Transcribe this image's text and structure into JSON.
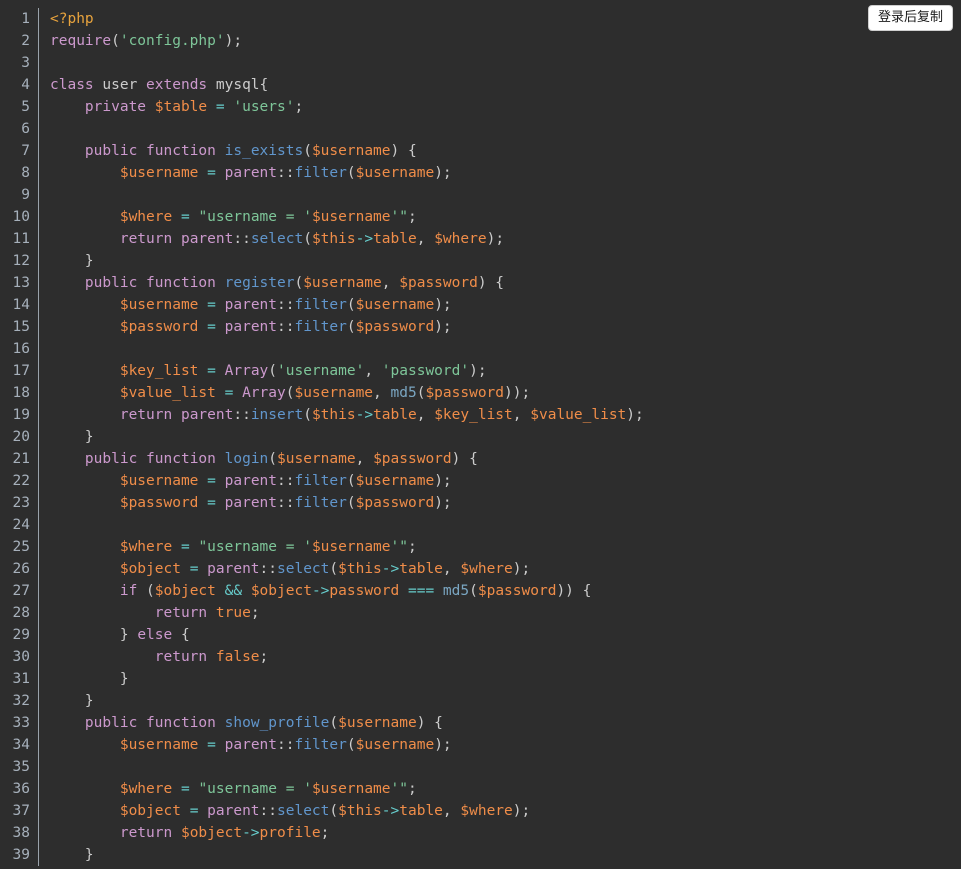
{
  "widget": {
    "type": "code-block",
    "language": "php",
    "theme": "dark",
    "background_color": "#2d2d2d",
    "default_text_color": "#cccccc",
    "gutter_separator_color": "#9aa3ab",
    "line_number_color": "#a6b0bb"
  },
  "copy_button": {
    "label": "登录后复制",
    "background_color": "#ffffff",
    "text_color": "#1a1a1a",
    "border_color": "#cfcfcf"
  },
  "token_colors": {
    "keyword": "#cc99cd",
    "function": "#6196cc",
    "builtin": "#7aa6c2",
    "variable": "#f08d49",
    "string": "#7ec699",
    "operator": "#67cdcc",
    "punctuation": "#cccccc",
    "php_tag": "#e8a33d",
    "boolean": "#f08d49",
    "property": "#f08d49",
    "classname": "#cccccc"
  },
  "line_numbers": [
    "1",
    "2",
    "3",
    "4",
    "5",
    "6",
    "7",
    "8",
    "9",
    "10",
    "11",
    "12",
    "13",
    "14",
    "15",
    "16",
    "17",
    "18",
    "19",
    "20",
    "21",
    "22",
    "23",
    "24",
    "25",
    "26",
    "27",
    "28",
    "29",
    "30",
    "31",
    "32",
    "33",
    "34",
    "35",
    "36",
    "37",
    "38",
    "39"
  ],
  "code_lines": [
    "<?php",
    "require('config.php');",
    "",
    "class user extends mysql{",
    "    private $table = 'users';",
    "",
    "    public function is_exists($username) {",
    "        $username = parent::filter($username);",
    "",
    "        $where = \"username = '$username'\";",
    "        return parent::select($this->table, $where);",
    "    }",
    "    public function register($username, $password) {",
    "        $username = parent::filter($username);",
    "        $password = parent::filter($password);",
    "",
    "        $key_list = Array('username', 'password');",
    "        $value_list = Array($username, md5($password));",
    "        return parent::insert($this->table, $key_list, $value_list);",
    "    }",
    "    public function login($username, $password) {",
    "        $username = parent::filter($username);",
    "        $password = parent::filter($password);",
    "",
    "        $where = \"username = '$username'\";",
    "        $object = parent::select($this->table, $where);",
    "        if ($object && $object->password === md5($password)) {",
    "            return true;",
    "        } else {",
    "            return false;",
    "        }",
    "    }",
    "    public function show_profile($username) {",
    "        $username = parent::filter($username);",
    "",
    "        $where = \"username = '$username'\";",
    "        $object = parent::select($this->table, $where);",
    "        return $object->profile;",
    "    }"
  ],
  "tokenized_lines": [
    [
      [
        "<?php",
        "tag"
      ]
    ],
    [
      [
        "require",
        "kw"
      ],
      [
        "(",
        "punct"
      ],
      [
        "'config.php'",
        "str"
      ],
      [
        ")",
        "punct"
      ],
      [
        ";",
        "punct"
      ]
    ],
    [],
    [
      [
        "class",
        "kw"
      ],
      [
        " ",
        "plain"
      ],
      [
        "user",
        "cls"
      ],
      [
        " ",
        "plain"
      ],
      [
        "extends",
        "kw"
      ],
      [
        " ",
        "plain"
      ],
      [
        "mysql",
        "cls"
      ],
      [
        "{",
        "punct"
      ]
    ],
    [
      [
        "    ",
        "plain"
      ],
      [
        "private",
        "kw"
      ],
      [
        " ",
        "plain"
      ],
      [
        "$table",
        "var"
      ],
      [
        " ",
        "plain"
      ],
      [
        "=",
        "op"
      ],
      [
        " ",
        "plain"
      ],
      [
        "'users'",
        "str"
      ],
      [
        ";",
        "punct"
      ]
    ],
    [],
    [
      [
        "    ",
        "plain"
      ],
      [
        "public",
        "kw"
      ],
      [
        " ",
        "plain"
      ],
      [
        "function",
        "kw"
      ],
      [
        " ",
        "plain"
      ],
      [
        "is_exists",
        "fn"
      ],
      [
        "(",
        "punct"
      ],
      [
        "$username",
        "var"
      ],
      [
        ")",
        "punct"
      ],
      [
        " ",
        "plain"
      ],
      [
        "{",
        "punct"
      ]
    ],
    [
      [
        "        ",
        "plain"
      ],
      [
        "$username",
        "var"
      ],
      [
        " ",
        "plain"
      ],
      [
        "=",
        "op"
      ],
      [
        " ",
        "plain"
      ],
      [
        "parent",
        "kw"
      ],
      [
        "::",
        "punct"
      ],
      [
        "filter",
        "fn"
      ],
      [
        "(",
        "punct"
      ],
      [
        "$username",
        "var"
      ],
      [
        ")",
        "punct"
      ],
      [
        ";",
        "punct"
      ]
    ],
    [],
    [
      [
        "        ",
        "plain"
      ],
      [
        "$where",
        "var"
      ],
      [
        " ",
        "plain"
      ],
      [
        "=",
        "op"
      ],
      [
        " ",
        "plain"
      ],
      [
        "\"username = '",
        "str"
      ],
      [
        "$username",
        "var"
      ],
      [
        "'\"",
        "str"
      ],
      [
        ";",
        "punct"
      ]
    ],
    [
      [
        "        ",
        "plain"
      ],
      [
        "return",
        "kw"
      ],
      [
        " ",
        "plain"
      ],
      [
        "parent",
        "kw"
      ],
      [
        "::",
        "punct"
      ],
      [
        "select",
        "fn"
      ],
      [
        "(",
        "punct"
      ],
      [
        "$this",
        "var"
      ],
      [
        "->",
        "op"
      ],
      [
        "table",
        "prop"
      ],
      [
        ",",
        "punct"
      ],
      [
        " ",
        "plain"
      ],
      [
        "$where",
        "var"
      ],
      [
        ")",
        "punct"
      ],
      [
        ";",
        "punct"
      ]
    ],
    [
      [
        "    ",
        "plain"
      ],
      [
        "}",
        "punct"
      ]
    ],
    [
      [
        "    ",
        "plain"
      ],
      [
        "public",
        "kw"
      ],
      [
        " ",
        "plain"
      ],
      [
        "function",
        "kw"
      ],
      [
        " ",
        "plain"
      ],
      [
        "register",
        "fn"
      ],
      [
        "(",
        "punct"
      ],
      [
        "$username",
        "var"
      ],
      [
        ",",
        "punct"
      ],
      [
        " ",
        "plain"
      ],
      [
        "$password",
        "var"
      ],
      [
        ")",
        "punct"
      ],
      [
        " ",
        "plain"
      ],
      [
        "{",
        "punct"
      ]
    ],
    [
      [
        "        ",
        "plain"
      ],
      [
        "$username",
        "var"
      ],
      [
        " ",
        "plain"
      ],
      [
        "=",
        "op"
      ],
      [
        " ",
        "plain"
      ],
      [
        "parent",
        "kw"
      ],
      [
        "::",
        "punct"
      ],
      [
        "filter",
        "fn"
      ],
      [
        "(",
        "punct"
      ],
      [
        "$username",
        "var"
      ],
      [
        ")",
        "punct"
      ],
      [
        ";",
        "punct"
      ]
    ],
    [
      [
        "        ",
        "plain"
      ],
      [
        "$password",
        "var"
      ],
      [
        " ",
        "plain"
      ],
      [
        "=",
        "op"
      ],
      [
        " ",
        "plain"
      ],
      [
        "parent",
        "kw"
      ],
      [
        "::",
        "punct"
      ],
      [
        "filter",
        "fn"
      ],
      [
        "(",
        "punct"
      ],
      [
        "$password",
        "var"
      ],
      [
        ")",
        "punct"
      ],
      [
        ";",
        "punct"
      ]
    ],
    [],
    [
      [
        "        ",
        "plain"
      ],
      [
        "$key_list",
        "var"
      ],
      [
        " ",
        "plain"
      ],
      [
        "=",
        "op"
      ],
      [
        " ",
        "plain"
      ],
      [
        "Array",
        "kw"
      ],
      [
        "(",
        "punct"
      ],
      [
        "'username'",
        "str"
      ],
      [
        ",",
        "punct"
      ],
      [
        " ",
        "plain"
      ],
      [
        "'password'",
        "str"
      ],
      [
        ")",
        "punct"
      ],
      [
        ";",
        "punct"
      ]
    ],
    [
      [
        "        ",
        "plain"
      ],
      [
        "$value_list",
        "var"
      ],
      [
        " ",
        "plain"
      ],
      [
        "=",
        "op"
      ],
      [
        " ",
        "plain"
      ],
      [
        "Array",
        "kw"
      ],
      [
        "(",
        "punct"
      ],
      [
        "$username",
        "var"
      ],
      [
        ",",
        "punct"
      ],
      [
        " ",
        "plain"
      ],
      [
        "md5",
        "builtin"
      ],
      [
        "(",
        "punct"
      ],
      [
        "$password",
        "var"
      ],
      [
        ")",
        "punct"
      ],
      [
        ")",
        "punct"
      ],
      [
        ";",
        "punct"
      ]
    ],
    [
      [
        "        ",
        "plain"
      ],
      [
        "return",
        "kw"
      ],
      [
        " ",
        "plain"
      ],
      [
        "parent",
        "kw"
      ],
      [
        "::",
        "punct"
      ],
      [
        "insert",
        "fn"
      ],
      [
        "(",
        "punct"
      ],
      [
        "$this",
        "var"
      ],
      [
        "->",
        "op"
      ],
      [
        "table",
        "prop"
      ],
      [
        ",",
        "punct"
      ],
      [
        " ",
        "plain"
      ],
      [
        "$key_list",
        "var"
      ],
      [
        ",",
        "punct"
      ],
      [
        " ",
        "plain"
      ],
      [
        "$value_list",
        "var"
      ],
      [
        ")",
        "punct"
      ],
      [
        ";",
        "punct"
      ]
    ],
    [
      [
        "    ",
        "plain"
      ],
      [
        "}",
        "punct"
      ]
    ],
    [
      [
        "    ",
        "plain"
      ],
      [
        "public",
        "kw"
      ],
      [
        " ",
        "plain"
      ],
      [
        "function",
        "kw"
      ],
      [
        " ",
        "plain"
      ],
      [
        "login",
        "fn"
      ],
      [
        "(",
        "punct"
      ],
      [
        "$username",
        "var"
      ],
      [
        ",",
        "punct"
      ],
      [
        " ",
        "plain"
      ],
      [
        "$password",
        "var"
      ],
      [
        ")",
        "punct"
      ],
      [
        " ",
        "plain"
      ],
      [
        "{",
        "punct"
      ]
    ],
    [
      [
        "        ",
        "plain"
      ],
      [
        "$username",
        "var"
      ],
      [
        " ",
        "plain"
      ],
      [
        "=",
        "op"
      ],
      [
        " ",
        "plain"
      ],
      [
        "parent",
        "kw"
      ],
      [
        "::",
        "punct"
      ],
      [
        "filter",
        "fn"
      ],
      [
        "(",
        "punct"
      ],
      [
        "$username",
        "var"
      ],
      [
        ")",
        "punct"
      ],
      [
        ";",
        "punct"
      ]
    ],
    [
      [
        "        ",
        "plain"
      ],
      [
        "$password",
        "var"
      ],
      [
        " ",
        "plain"
      ],
      [
        "=",
        "op"
      ],
      [
        " ",
        "plain"
      ],
      [
        "parent",
        "kw"
      ],
      [
        "::",
        "punct"
      ],
      [
        "filter",
        "fn"
      ],
      [
        "(",
        "punct"
      ],
      [
        "$password",
        "var"
      ],
      [
        ")",
        "punct"
      ],
      [
        ";",
        "punct"
      ]
    ],
    [],
    [
      [
        "        ",
        "plain"
      ],
      [
        "$where",
        "var"
      ],
      [
        " ",
        "plain"
      ],
      [
        "=",
        "op"
      ],
      [
        " ",
        "plain"
      ],
      [
        "\"username = '",
        "str"
      ],
      [
        "$username",
        "var"
      ],
      [
        "'\"",
        "str"
      ],
      [
        ";",
        "punct"
      ]
    ],
    [
      [
        "        ",
        "plain"
      ],
      [
        "$object",
        "var"
      ],
      [
        " ",
        "plain"
      ],
      [
        "=",
        "op"
      ],
      [
        " ",
        "plain"
      ],
      [
        "parent",
        "kw"
      ],
      [
        "::",
        "punct"
      ],
      [
        "select",
        "fn"
      ],
      [
        "(",
        "punct"
      ],
      [
        "$this",
        "var"
      ],
      [
        "->",
        "op"
      ],
      [
        "table",
        "prop"
      ],
      [
        ",",
        "punct"
      ],
      [
        " ",
        "plain"
      ],
      [
        "$where",
        "var"
      ],
      [
        ")",
        "punct"
      ],
      [
        ";",
        "punct"
      ]
    ],
    [
      [
        "        ",
        "plain"
      ],
      [
        "if",
        "kw"
      ],
      [
        " ",
        "plain"
      ],
      [
        "(",
        "punct"
      ],
      [
        "$object",
        "var"
      ],
      [
        " ",
        "plain"
      ],
      [
        "&&",
        "op"
      ],
      [
        " ",
        "plain"
      ],
      [
        "$object",
        "var"
      ],
      [
        "->",
        "op"
      ],
      [
        "password",
        "prop"
      ],
      [
        " ",
        "plain"
      ],
      [
        "===",
        "op"
      ],
      [
        " ",
        "plain"
      ],
      [
        "md5",
        "builtin"
      ],
      [
        "(",
        "punct"
      ],
      [
        "$password",
        "var"
      ],
      [
        ")",
        "punct"
      ],
      [
        ")",
        "punct"
      ],
      [
        " ",
        "plain"
      ],
      [
        "{",
        "punct"
      ]
    ],
    [
      [
        "            ",
        "plain"
      ],
      [
        "return",
        "kw"
      ],
      [
        " ",
        "plain"
      ],
      [
        "true",
        "bool"
      ],
      [
        ";",
        "punct"
      ]
    ],
    [
      [
        "        ",
        "plain"
      ],
      [
        "}",
        "punct"
      ],
      [
        " ",
        "plain"
      ],
      [
        "else",
        "kw"
      ],
      [
        " ",
        "plain"
      ],
      [
        "{",
        "punct"
      ]
    ],
    [
      [
        "            ",
        "plain"
      ],
      [
        "return",
        "kw"
      ],
      [
        " ",
        "plain"
      ],
      [
        "false",
        "bool"
      ],
      [
        ";",
        "punct"
      ]
    ],
    [
      [
        "        ",
        "plain"
      ],
      [
        "}",
        "punct"
      ]
    ],
    [
      [
        "    ",
        "plain"
      ],
      [
        "}",
        "punct"
      ]
    ],
    [
      [
        "    ",
        "plain"
      ],
      [
        "public",
        "kw"
      ],
      [
        " ",
        "plain"
      ],
      [
        "function",
        "kw"
      ],
      [
        " ",
        "plain"
      ],
      [
        "show_profile",
        "fn"
      ],
      [
        "(",
        "punct"
      ],
      [
        "$username",
        "var"
      ],
      [
        ")",
        "punct"
      ],
      [
        " ",
        "plain"
      ],
      [
        "{",
        "punct"
      ]
    ],
    [
      [
        "        ",
        "plain"
      ],
      [
        "$username",
        "var"
      ],
      [
        " ",
        "plain"
      ],
      [
        "=",
        "op"
      ],
      [
        " ",
        "plain"
      ],
      [
        "parent",
        "kw"
      ],
      [
        "::",
        "punct"
      ],
      [
        "filter",
        "fn"
      ],
      [
        "(",
        "punct"
      ],
      [
        "$username",
        "var"
      ],
      [
        ")",
        "punct"
      ],
      [
        ";",
        "punct"
      ]
    ],
    [],
    [
      [
        "        ",
        "plain"
      ],
      [
        "$where",
        "var"
      ],
      [
        " ",
        "plain"
      ],
      [
        "=",
        "op"
      ],
      [
        " ",
        "plain"
      ],
      [
        "\"username = '",
        "str"
      ],
      [
        "$username",
        "var"
      ],
      [
        "'\"",
        "str"
      ],
      [
        ";",
        "punct"
      ]
    ],
    [
      [
        "        ",
        "plain"
      ],
      [
        "$object",
        "var"
      ],
      [
        " ",
        "plain"
      ],
      [
        "=",
        "op"
      ],
      [
        " ",
        "plain"
      ],
      [
        "parent",
        "kw"
      ],
      [
        "::",
        "punct"
      ],
      [
        "select",
        "fn"
      ],
      [
        "(",
        "punct"
      ],
      [
        "$this",
        "var"
      ],
      [
        "->",
        "op"
      ],
      [
        "table",
        "prop"
      ],
      [
        ",",
        "punct"
      ],
      [
        " ",
        "plain"
      ],
      [
        "$where",
        "var"
      ],
      [
        ")",
        "punct"
      ],
      [
        ";",
        "punct"
      ]
    ],
    [
      [
        "        ",
        "plain"
      ],
      [
        "return",
        "kw"
      ],
      [
        " ",
        "plain"
      ],
      [
        "$object",
        "var"
      ],
      [
        "->",
        "op"
      ],
      [
        "profile",
        "prop"
      ],
      [
        ";",
        "punct"
      ]
    ],
    [
      [
        "    ",
        "plain"
      ],
      [
        "}",
        "punct"
      ]
    ]
  ]
}
